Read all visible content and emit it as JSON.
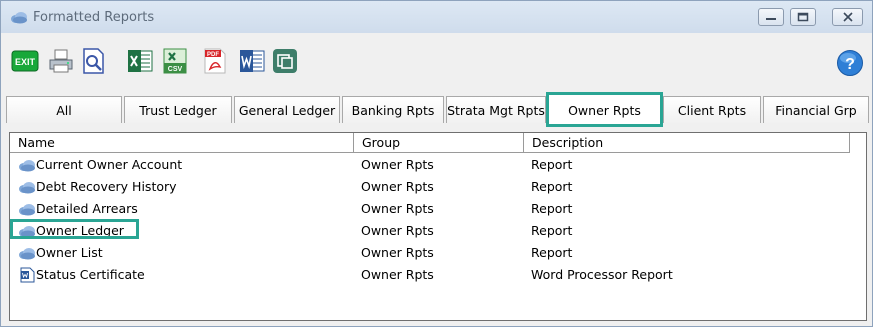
{
  "window": {
    "title": "Formatted Reports",
    "icons": [
      "app-cloud-icon",
      "minimize-icon",
      "maximize-icon",
      "close-icon"
    ]
  },
  "toolbar": {
    "exit_label": "EXIT",
    "buttons": [
      {
        "name": "exit-button",
        "icon": "exit-icon"
      },
      {
        "name": "print-button",
        "icon": "printer-icon"
      },
      {
        "name": "preview-button",
        "icon": "print-preview-icon"
      },
      {
        "name": "excel-button",
        "icon": "excel-icon"
      },
      {
        "name": "csv-button",
        "icon": "csv-icon"
      },
      {
        "name": "pdf-button",
        "icon": "pdf-icon"
      },
      {
        "name": "word-button",
        "icon": "word-icon"
      },
      {
        "name": "copy-button",
        "icon": "copy-window-icon"
      }
    ],
    "csv_label": "CSV",
    "pdf_label": "PDF",
    "help_icon": "help-icon"
  },
  "tabs": [
    {
      "label": "All",
      "active": false
    },
    {
      "label": "Trust Ledger",
      "active": false
    },
    {
      "label": "General Ledger",
      "active": false
    },
    {
      "label": "Banking Rpts",
      "active": false
    },
    {
      "label": "Strata Mgt Rpts",
      "active": false
    },
    {
      "label": "Owner Rpts",
      "active": true
    },
    {
      "label": "Client Rpts",
      "active": false
    },
    {
      "label": "Financial Grp",
      "active": false
    }
  ],
  "list": {
    "columns": [
      "Name",
      "Group",
      "Description"
    ],
    "rows": [
      {
        "name": "Current Owner Account",
        "group": "Owner Rpts",
        "description": "Report",
        "icon": "report-cloud-icon"
      },
      {
        "name": "Debt Recovery History",
        "group": "Owner Rpts",
        "description": "Report",
        "icon": "report-cloud-icon"
      },
      {
        "name": "Detailed Arrears",
        "group": "Owner Rpts",
        "description": "Report",
        "icon": "report-cloud-icon"
      },
      {
        "name": "Owner Ledger",
        "group": "Owner Rpts",
        "description": "Report",
        "icon": "report-cloud-icon",
        "highlighted": true
      },
      {
        "name": "Owner List",
        "group": "Owner Rpts",
        "description": "Report",
        "icon": "report-cloud-icon"
      },
      {
        "name": "Status Certificate",
        "group": "Owner Rpts",
        "description": "Word Processor Report",
        "icon": "word-document-icon"
      }
    ]
  },
  "colors": {
    "highlight": "#2aa594",
    "title_text": "#5d6b7b",
    "excel_green": "#1f7244",
    "pdf_red": "#d8262a",
    "word_blue": "#2b579a"
  }
}
